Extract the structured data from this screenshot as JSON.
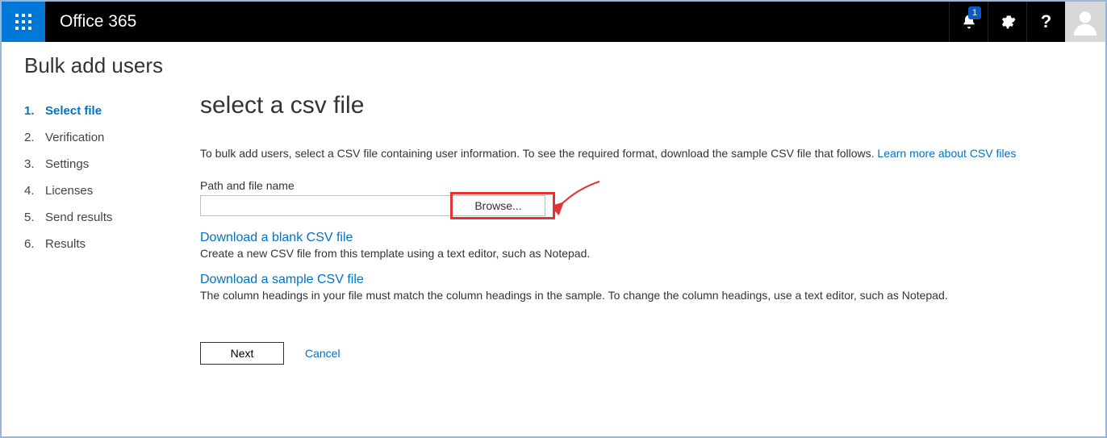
{
  "header": {
    "brand": "Office 365",
    "notification_count": "1"
  },
  "page_title": "Bulk add users",
  "steps": [
    {
      "num": "1.",
      "label": "Select file",
      "active": true
    },
    {
      "num": "2.",
      "label": "Verification",
      "active": false
    },
    {
      "num": "3.",
      "label": "Settings",
      "active": false
    },
    {
      "num": "4.",
      "label": "Licenses",
      "active": false
    },
    {
      "num": "5.",
      "label": "Send results",
      "active": false
    },
    {
      "num": "6.",
      "label": "Results",
      "active": false
    }
  ],
  "main": {
    "heading": "select a csv file",
    "intro_text": "To bulk add users, select a CSV file containing user information. To see the required format, download the sample CSV file that follows. ",
    "intro_link": "Learn more about CSV files",
    "field_label": "Path and file name",
    "path_value": "",
    "browse_label": "Browse...",
    "blank_link": "Download a blank CSV file",
    "blank_desc": "Create a new CSV file from this template using a text editor, such as Notepad.",
    "sample_link": "Download a sample CSV file",
    "sample_desc": "The column headings in your file must match the column headings in the sample. To change the column headings, use a text editor, such as Notepad.",
    "next_label": "Next",
    "cancel_label": "Cancel"
  }
}
